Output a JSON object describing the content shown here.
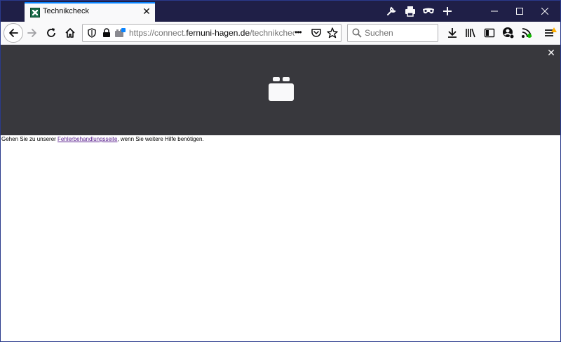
{
  "tab": {
    "title": "Technikcheck",
    "close": "✕"
  },
  "urlbar": {
    "url_prefix": "https://connect.",
    "url_host": "fernuni-hagen.de",
    "url_path": "/technikcheck",
    "more": "•••"
  },
  "search": {
    "placeholder": "Suchen"
  },
  "video": {
    "close": "✕"
  },
  "help": {
    "before": "Gehen Sie zu unserer ",
    "link": "Fehlerbehandlungsseite",
    "after": ", wenn Sie weitere Hilfe benötigen."
  },
  "window": {
    "minimize": "—",
    "maximize": "☐",
    "close": "✕"
  }
}
